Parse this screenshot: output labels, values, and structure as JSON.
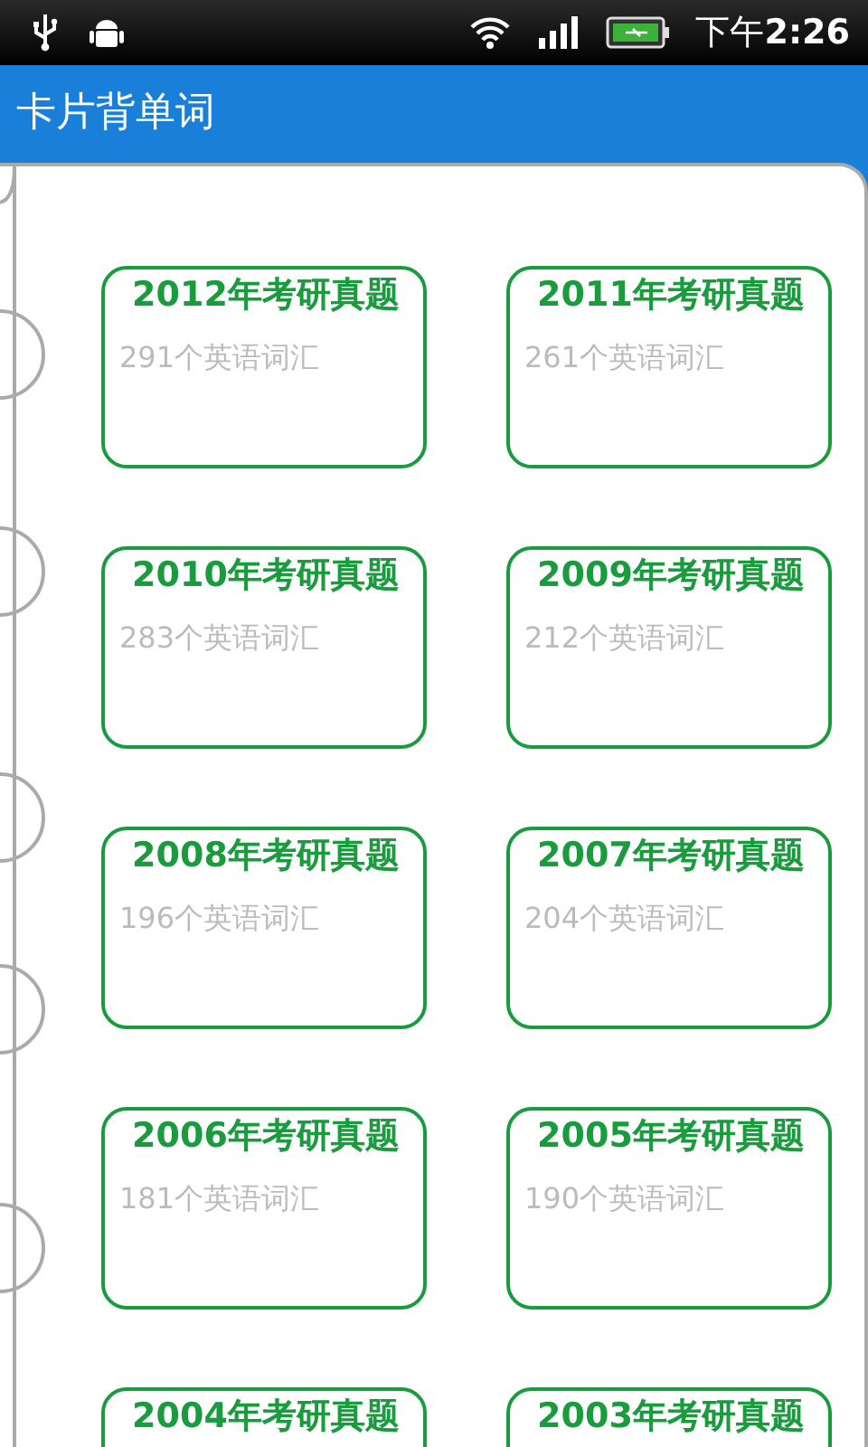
{
  "status_bar": {
    "time": "下午**2:26**"
  },
  "app_bar": {
    "title": "卡片背单词"
  },
  "cards": [
    {
      "title": "2012年考研真题",
      "count": "291个英语词汇"
    },
    {
      "title": "2011年考研真题",
      "count": "261个英语词汇"
    },
    {
      "title": "2010年考研真题",
      "count": "283个英语词汇"
    },
    {
      "title": "2009年考研真题",
      "count": "212个英语词汇"
    },
    {
      "title": "2008年考研真题",
      "count": "196个英语词汇"
    },
    {
      "title": "2007年考研真题",
      "count": "204个英语词汇"
    },
    {
      "title": "2006年考研真题",
      "count": "181个英语词汇"
    },
    {
      "title": "2005年考研真题",
      "count": "190个英语词汇"
    },
    {
      "title": "2004年考研真题"
    },
    {
      "title": "2003年考研真题"
    }
  ]
}
